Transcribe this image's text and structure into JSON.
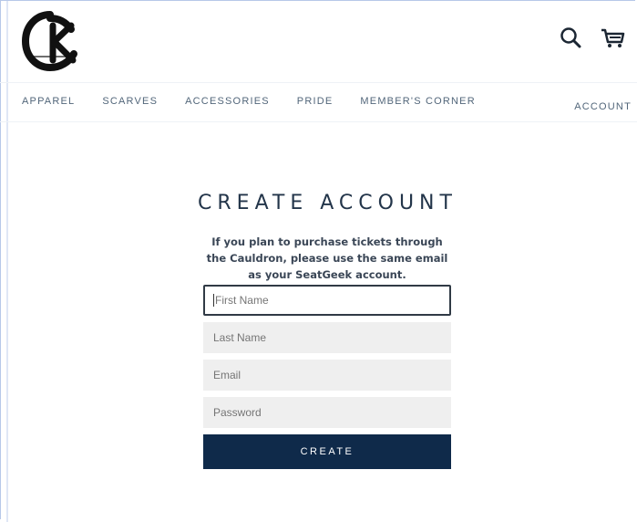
{
  "header": {
    "logo_icon": "crest-logo-icon",
    "search_icon": "search-icon",
    "cart_icon": "cart-icon",
    "brand_color": "#0f2a4a"
  },
  "nav": {
    "items": [
      {
        "label": "APPAREL"
      },
      {
        "label": "SCARVES"
      },
      {
        "label": "ACCESSORIES"
      },
      {
        "label": "PRIDE"
      },
      {
        "label": "MEMBER'S CORNER"
      }
    ],
    "account_label": "ACCOUNT"
  },
  "main": {
    "title": "CREATE ACCOUNT",
    "subtitle": "If you plan to purchase tickets through the Cauldron, please use the same email as your SeatGeek account.",
    "fields": [
      {
        "placeholder": "First Name",
        "focused": true
      },
      {
        "placeholder": "Last Name",
        "focused": false
      },
      {
        "placeholder": "Email",
        "focused": false
      },
      {
        "placeholder": "Password",
        "focused": false
      }
    ],
    "create_label": "CREATE"
  }
}
